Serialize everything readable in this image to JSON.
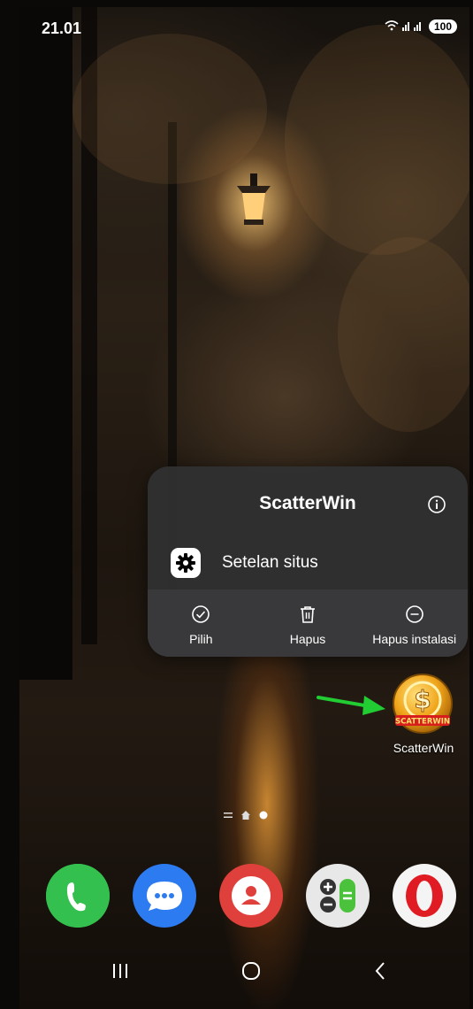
{
  "status_bar": {
    "time": "21.01",
    "battery": "100"
  },
  "context_menu": {
    "title": "ScatterWin",
    "site_settings_label": "Setelan situs",
    "actions": [
      {
        "label": "Pilih",
        "icon": "check-circle-icon"
      },
      {
        "label": "Hapus",
        "icon": "trash-icon"
      },
      {
        "label": "Hapus instalasi",
        "icon": "minus-circle-icon"
      }
    ]
  },
  "app": {
    "label": "ScatterWin",
    "icon_text": "SCATTERWIN"
  },
  "dock": [
    {
      "name": "phone",
      "icon": "phone-icon",
      "color": "#2db24a"
    },
    {
      "name": "messages",
      "icon": "chat-icon",
      "color": "#2d7bf0"
    },
    {
      "name": "contacts",
      "icon": "person-icon",
      "color": "#e0403b"
    },
    {
      "name": "calculator",
      "icon": "calculator-icon",
      "color": "#6fcf3f"
    },
    {
      "name": "opera",
      "icon": "opera-icon",
      "color": "#e01b24"
    }
  ],
  "colors": {
    "menu_bg": "#303032",
    "arrow": "#22cc33",
    "text": "#ffffff"
  }
}
